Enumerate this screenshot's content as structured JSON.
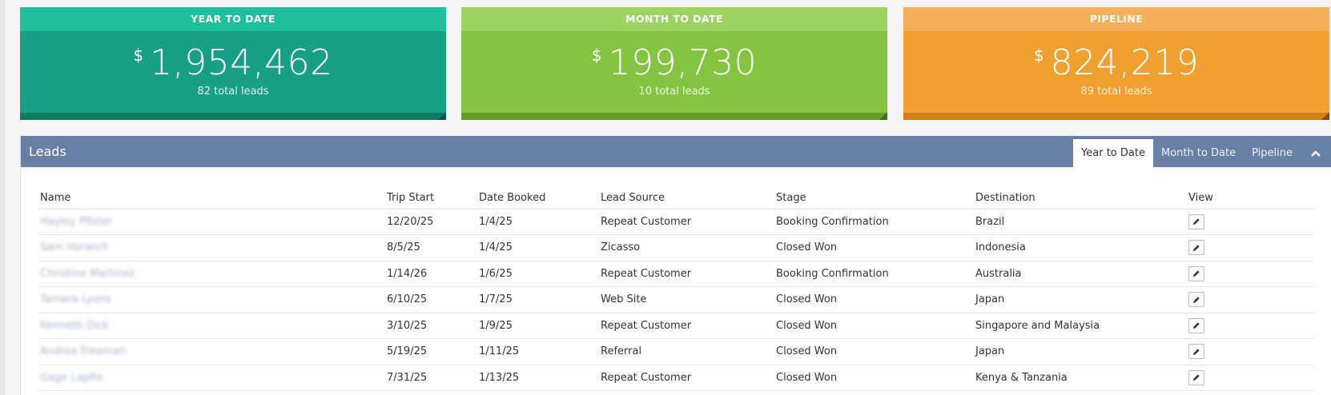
{
  "cards": [
    {
      "title": "YEAR TO DATE",
      "currency": "$",
      "amount": "1,954,462",
      "sub": "82 total leads"
    },
    {
      "title": "MONTH TO DATE",
      "currency": "$",
      "amount": "199,730",
      "sub": "10 total leads"
    },
    {
      "title": "PIPELINE",
      "currency": "$",
      "amount": "824,219",
      "sub": "89 total leads"
    }
  ],
  "leads": {
    "title": "Leads",
    "tabs": [
      "Year to Date",
      "Month to Date",
      "Pipeline"
    ],
    "active_tab": "Year to Date",
    "collapse_icon": "chevron-up-icon",
    "columns": [
      "Name",
      "Trip Start",
      "Date Booked",
      "Lead Source",
      "Stage",
      "Destination",
      "View"
    ],
    "rows": [
      {
        "name": "Hayley Pfister",
        "trip_start": "12/20/25",
        "date_booked": "1/4/25",
        "lead_source": "Repeat Customer",
        "stage": "Booking Confirmation",
        "destination": "Brazil",
        "view_icon": "pencil-icon"
      },
      {
        "name": "Sam Horwich",
        "trip_start": "8/5/25",
        "date_booked": "1/4/25",
        "lead_source": "Zicasso",
        "stage": "Closed Won",
        "destination": "Indonesia",
        "view_icon": "pencil-icon"
      },
      {
        "name": "Christine Martinez",
        "trip_start": "1/14/26",
        "date_booked": "1/6/25",
        "lead_source": "Repeat Customer",
        "stage": "Booking Confirmation",
        "destination": "Australia",
        "view_icon": "pencil-icon"
      },
      {
        "name": "Tamara Lyons",
        "trip_start": "6/10/25",
        "date_booked": "1/7/25",
        "lead_source": "Web Site",
        "stage": "Closed Won",
        "destination": "Japan",
        "view_icon": "pencil-icon"
      },
      {
        "name": "Kenneth Dick",
        "trip_start": "3/10/25",
        "date_booked": "1/9/25",
        "lead_source": "Repeat Customer",
        "stage": "Closed Won",
        "destination": "Singapore and Malaysia",
        "view_icon": "pencil-icon"
      },
      {
        "name": "Andrea Freeman",
        "trip_start": "5/19/25",
        "date_booked": "1/11/25",
        "lead_source": "Referral",
        "stage": "Closed Won",
        "destination": "Japan",
        "view_icon": "pencil-icon"
      },
      {
        "name": "Gage Laplte",
        "trip_start": "7/31/25",
        "date_booked": "1/13/25",
        "lead_source": "Repeat Customer",
        "stage": "Closed Won",
        "destination": "Kenya & Tanzania",
        "view_icon": "pencil-icon"
      }
    ]
  },
  "colors": {
    "ytd": "#17a085",
    "mtd": "#84c441",
    "pipeline": "#f0a030",
    "panel_header": "#6880a5"
  }
}
